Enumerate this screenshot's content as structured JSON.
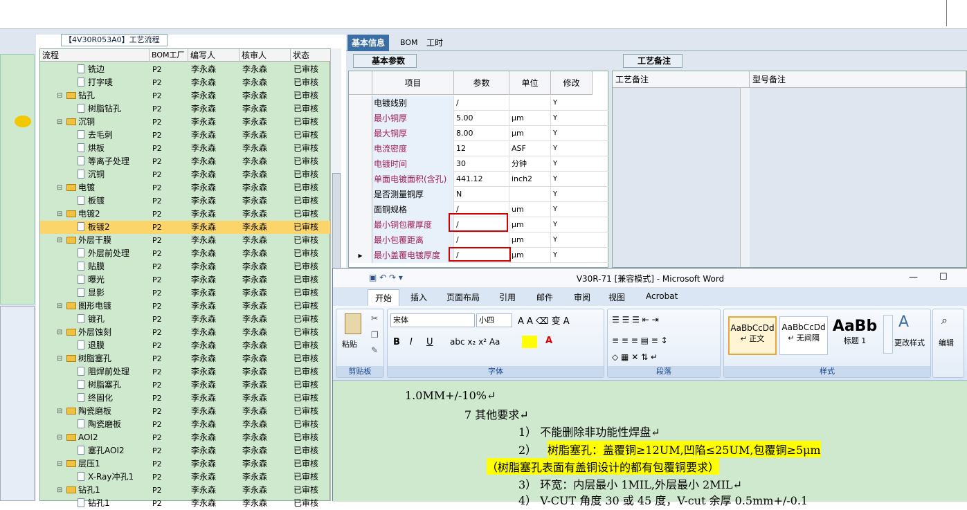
{
  "flow_title": "【4V30R053A0】工艺流程",
  "tree": {
    "headers": [
      "流程",
      "BOM工厂",
      "编写人",
      "核审人",
      "状态"
    ],
    "rows": [
      {
        "name": "铣边",
        "type": "leaf",
        "indent": 1,
        "bom": "P2",
        "writer": "李永森",
        "reviewer": "李永森",
        "status": "已审核"
      },
      {
        "name": "打字唛",
        "type": "leaf",
        "indent": 1,
        "bom": "P2",
        "writer": "李永森",
        "reviewer": "李永森",
        "status": "已审核"
      },
      {
        "name": "钻孔",
        "type": "folder",
        "indent": 0,
        "bom": "P2",
        "writer": "李永森",
        "reviewer": "李永森",
        "status": "已审核"
      },
      {
        "name": "树脂钻孔",
        "type": "leaf",
        "indent": 1,
        "bom": "P2",
        "writer": "李永森",
        "reviewer": "李永森",
        "status": "已审核"
      },
      {
        "name": "沉铜",
        "type": "folder",
        "indent": 0,
        "bom": "P2",
        "writer": "李永森",
        "reviewer": "李永森",
        "status": "已审核"
      },
      {
        "name": "去毛刺",
        "type": "leaf",
        "indent": 1,
        "bom": "P2",
        "writer": "李永森",
        "reviewer": "李永森",
        "status": "已审核"
      },
      {
        "name": "烘板",
        "type": "leaf",
        "indent": 1,
        "bom": "P2",
        "writer": "李永森",
        "reviewer": "李永森",
        "status": "已审核"
      },
      {
        "name": "等离子处理",
        "type": "leaf",
        "indent": 1,
        "bom": "P2",
        "writer": "李永森",
        "reviewer": "李永森",
        "status": "已审核"
      },
      {
        "name": "沉铜",
        "type": "leaf",
        "indent": 1,
        "bom": "P2",
        "writer": "李永森",
        "reviewer": "李永森",
        "status": "已审核"
      },
      {
        "name": "电镀",
        "type": "folder",
        "indent": 0,
        "bom": "P2",
        "writer": "李永森",
        "reviewer": "李永森",
        "status": "已审核"
      },
      {
        "name": "板镀",
        "type": "leaf",
        "indent": 1,
        "bom": "P2",
        "writer": "李永森",
        "reviewer": "李永森",
        "status": "已审核"
      },
      {
        "name": "电镀2",
        "type": "folder",
        "indent": 0,
        "bom": "P2",
        "writer": "李永森",
        "reviewer": "李永森",
        "status": "已审核"
      },
      {
        "name": "板镀2",
        "type": "leaf",
        "indent": 1,
        "bom": "P2",
        "writer": "李永森",
        "reviewer": "李永森",
        "status": "已审核",
        "selected": true
      },
      {
        "name": "外层干膜",
        "type": "folder",
        "indent": 0,
        "bom": "P2",
        "writer": "李永森",
        "reviewer": "李永森",
        "status": "已审核"
      },
      {
        "name": "外层前处理",
        "type": "leaf",
        "indent": 1,
        "bom": "P2",
        "writer": "李永森",
        "reviewer": "李永森",
        "status": "已审核"
      },
      {
        "name": "贴膜",
        "type": "leaf",
        "indent": 1,
        "bom": "P2",
        "writer": "李永森",
        "reviewer": "李永森",
        "status": "已审核"
      },
      {
        "name": "曝光",
        "type": "leaf",
        "indent": 1,
        "bom": "P2",
        "writer": "李永森",
        "reviewer": "李永森",
        "status": "已审核"
      },
      {
        "name": "显影",
        "type": "leaf",
        "indent": 1,
        "bom": "P2",
        "writer": "李永森",
        "reviewer": "李永森",
        "status": "已审核"
      },
      {
        "name": "图形电镀",
        "type": "folder",
        "indent": 0,
        "bom": "P2",
        "writer": "李永森",
        "reviewer": "李永森",
        "status": "已审核"
      },
      {
        "name": "镀孔",
        "type": "leaf",
        "indent": 1,
        "bom": "P2",
        "writer": "李永森",
        "reviewer": "李永森",
        "status": "已审核"
      },
      {
        "name": "外层蚀刻",
        "type": "folder",
        "indent": 0,
        "bom": "P2",
        "writer": "李永森",
        "reviewer": "李永森",
        "status": "已审核"
      },
      {
        "name": "退膜",
        "type": "leaf",
        "indent": 1,
        "bom": "P2",
        "writer": "李永森",
        "reviewer": "李永森",
        "status": "已审核"
      },
      {
        "name": "树脂塞孔",
        "type": "folder",
        "indent": 0,
        "bom": "P2",
        "writer": "李永森",
        "reviewer": "李永森",
        "status": "已审核"
      },
      {
        "name": "阻焊前处理",
        "type": "leaf",
        "indent": 1,
        "bom": "P2",
        "writer": "李永森",
        "reviewer": "李永森",
        "status": "已审核"
      },
      {
        "name": "树脂塞孔",
        "type": "leaf",
        "indent": 1,
        "bom": "P2",
        "writer": "李永森",
        "reviewer": "李永森",
        "status": "已审核"
      },
      {
        "name": "终固化",
        "type": "leaf",
        "indent": 1,
        "bom": "P2",
        "writer": "李永森",
        "reviewer": "李永森",
        "status": "已审核"
      },
      {
        "name": "陶瓷磨板",
        "type": "folder",
        "indent": 0,
        "bom": "P2",
        "writer": "李永森",
        "reviewer": "李永森",
        "status": "已审核"
      },
      {
        "name": "陶瓷磨板",
        "type": "leaf",
        "indent": 1,
        "bom": "P2",
        "writer": "李永森",
        "reviewer": "李永森",
        "status": "已审核"
      },
      {
        "name": "AOI2",
        "type": "folder",
        "indent": 0,
        "bom": "P2",
        "writer": "李永森",
        "reviewer": "李永森",
        "status": "已审核"
      },
      {
        "name": "塞孔AOI2",
        "type": "leaf",
        "indent": 1,
        "bom": "P2",
        "writer": "李永森",
        "reviewer": "李永森",
        "status": "已审核"
      },
      {
        "name": "层压1",
        "type": "folder",
        "indent": 0,
        "bom": "P2",
        "writer": "李永森",
        "reviewer": "李永森",
        "status": "已审核"
      },
      {
        "name": "X-Ray冲孔1",
        "type": "leaf",
        "indent": 1,
        "bom": "P2",
        "writer": "李永森",
        "reviewer": "李永森",
        "status": "已审核"
      },
      {
        "name": "钻孔1",
        "type": "folder",
        "indent": 0,
        "bom": "P2",
        "writer": "李永森",
        "reviewer": "李永森",
        "status": "已审核"
      },
      {
        "name": "钻孔1",
        "type": "leaf",
        "indent": 1,
        "bom": "P2",
        "writer": "李永森",
        "reviewer": "李永森",
        "status": "已审核"
      }
    ]
  },
  "right_tabs": [
    "基本信息",
    "BOM",
    "工时"
  ],
  "params": {
    "section_title": "基本参数",
    "headers": [
      "项目",
      "参数",
      "单位",
      "修改"
    ],
    "rows": [
      {
        "item": "电镀线别",
        "value": "/",
        "unit": "",
        "mod": "Y",
        "red": false
      },
      {
        "item": "最小铜厚",
        "value": "5.00",
        "unit": "μm",
        "mod": "Y",
        "red": true
      },
      {
        "item": "最大铜厚",
        "value": "8.00",
        "unit": "μm",
        "mod": "Y",
        "red": true
      },
      {
        "item": "电流密度",
        "value": "12",
        "unit": "ASF",
        "mod": "Y",
        "red": true
      },
      {
        "item": "电镀时间",
        "value": "30",
        "unit": "分钟",
        "mod": "Y",
        "red": true
      },
      {
        "item": "单面电镀面积(含孔)",
        "value": "441.12",
        "unit": "inch2",
        "mod": "Y",
        "red": true
      },
      {
        "item": "是否测量铜厚",
        "value": "N",
        "unit": "",
        "mod": "Y",
        "red": false
      },
      {
        "item": "面铜规格",
        "value": "/",
        "unit": "um",
        "mod": "Y",
        "red": false
      },
      {
        "item": "最小铜包覆厚度",
        "value": "/",
        "unit": "μm",
        "mod": "Y",
        "red": true
      },
      {
        "item": "最小包覆距离",
        "value": "/",
        "unit": "μm",
        "mod": "Y",
        "red": true
      },
      {
        "item": "最小盖覆电镀厚度",
        "value": "/",
        "unit": "μm",
        "mod": "Y",
        "red": true
      }
    ]
  },
  "notes": {
    "section_title": "工艺备注",
    "col1": "工艺备注",
    "col2": "型号备注"
  },
  "word": {
    "title": "V30R-71 [兼容模式] - Microsoft Word",
    "tabs": [
      "开始",
      "插入",
      "页面布局",
      "引用",
      "邮件",
      "审阅",
      "视图",
      "Acrobat"
    ],
    "font_name": "宋体",
    "font_size": "小四",
    "paste_label": "粘贴",
    "group_labels": [
      "剪贴板",
      "字体",
      "段落",
      "样式"
    ],
    "styles": [
      {
        "preview": "AaBbCcDd",
        "name": "↵ 正文"
      },
      {
        "preview": "AaBbCcDd",
        "name": "↵ 无间隔"
      },
      {
        "preview": "AaBb",
        "name": "标题 1"
      }
    ],
    "change_styles": "更改样式",
    "edit_label": "编辑",
    "lines": [
      "1.0MM+/-10%↵",
      "7 其他要求↵",
      "1） 不能删除非功能性焊盘↵",
      "2）",
      "树脂塞孔：盖覆铜≥12UM,凹陷≤25UM,包覆铜≥5μm",
      "（树脂塞孔表面有盖铜设计的都有包覆铜要求）",
      "3） 环宽：内层最小 1MIL,外层最小 2MIL↵",
      "4） V-CUT 角度 30 或 45 度，V-cut 余厚 0.5mm+/-0.1"
    ]
  }
}
